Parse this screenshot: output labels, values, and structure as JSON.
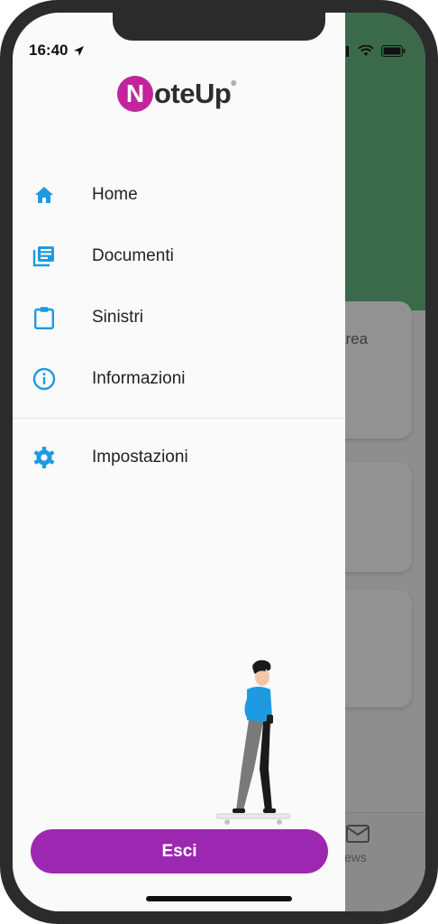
{
  "status_bar": {
    "time": "16:40"
  },
  "brand": {
    "logo_letter": "N",
    "logo_text": "oteUp",
    "registered": "®",
    "accent": "#c2249d"
  },
  "drawer": {
    "items": [
      {
        "label": "Home",
        "icon": "home-icon"
      },
      {
        "label": "Documenti",
        "icon": "documents-icon"
      },
      {
        "label": "Sinistri",
        "icon": "clipboard-icon"
      },
      {
        "label": "Informazioni",
        "icon": "info-icon"
      }
    ],
    "settings": {
      "label": "Impostazioni",
      "icon": "gear-icon"
    },
    "logout_label": "Esci",
    "icon_color": "#1e9be0",
    "button_color": "#9c27b0"
  },
  "background": {
    "card_text": "area",
    "tab_label": "ews"
  }
}
